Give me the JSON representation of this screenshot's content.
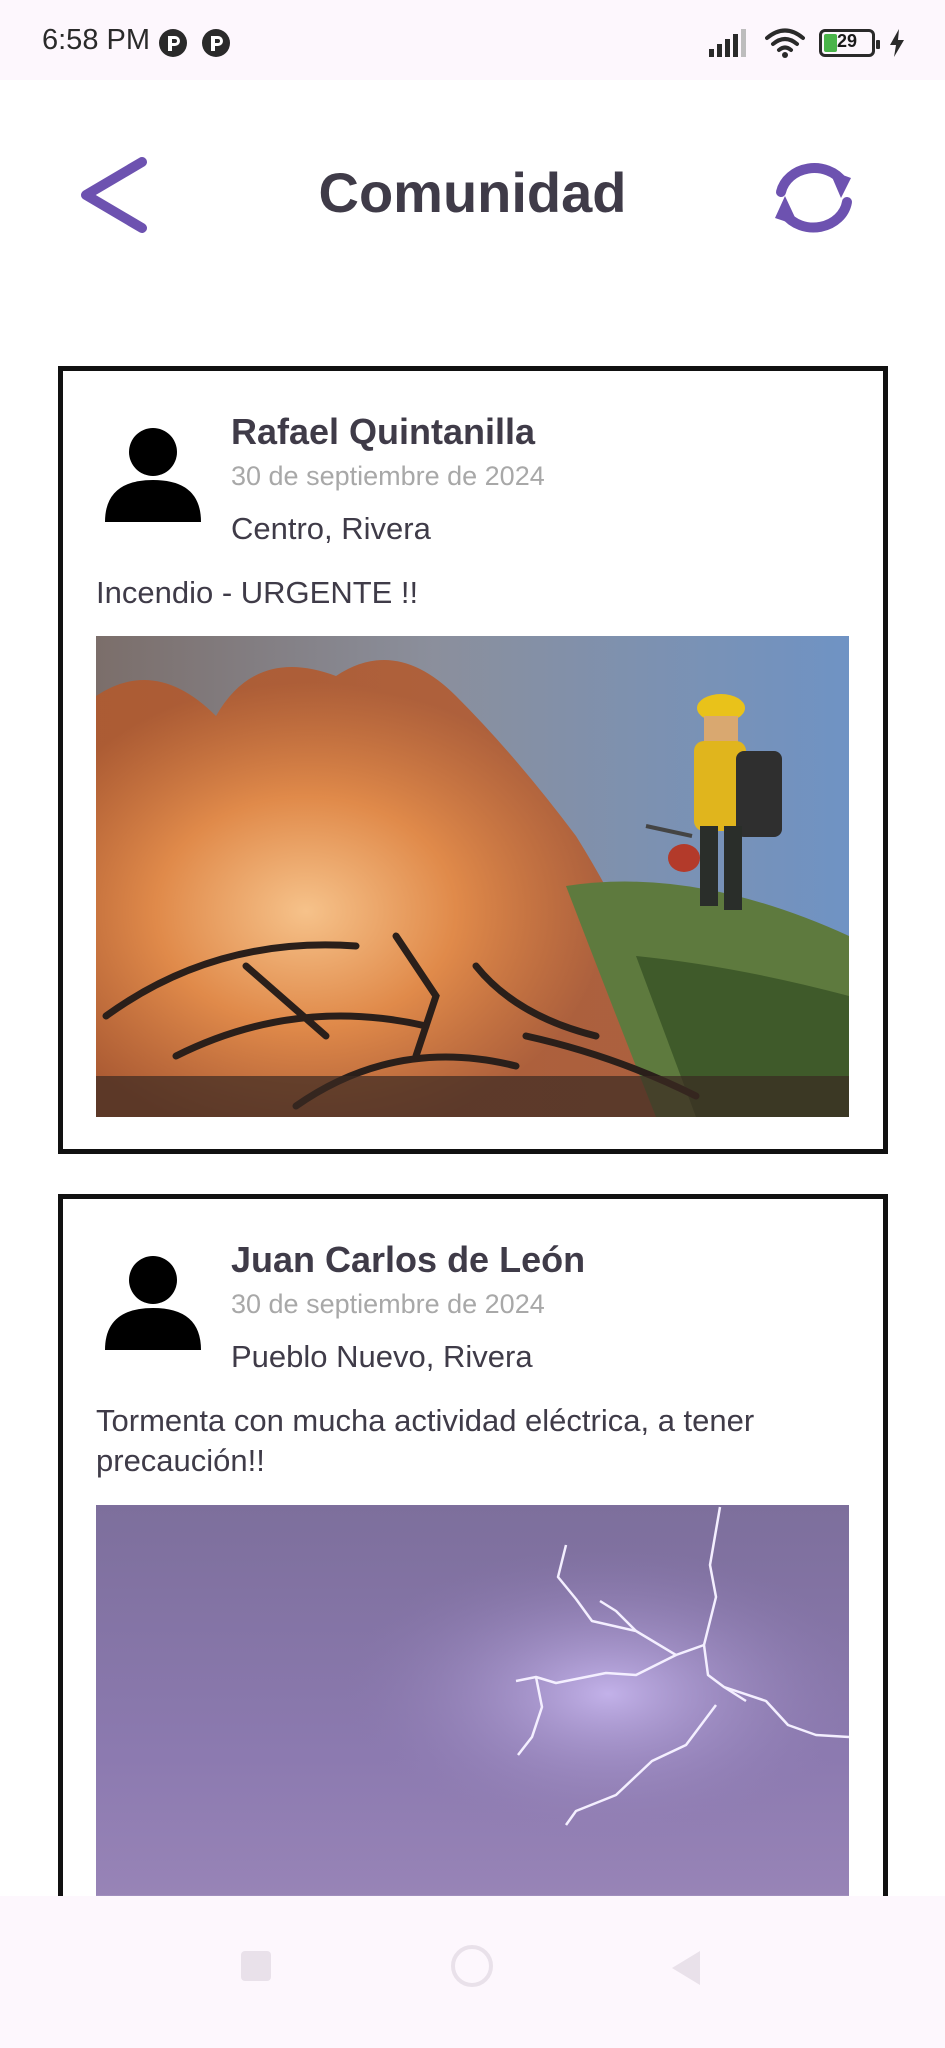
{
  "status_bar": {
    "time": "6:58 PM",
    "battery_level": "29",
    "battery_fraction": 0.29,
    "icons": [
      "app-notification-icon",
      "app-notification-icon",
      "signal-icon",
      "wifi-icon",
      "battery-icon",
      "charging-icon"
    ]
  },
  "header": {
    "title": "Comunidad",
    "back_icon": "chevron-left-icon",
    "refresh_icon": "refresh-icon"
  },
  "posts": [
    {
      "author": "Rafael Quintanilla",
      "date": "30 de septiembre de 2024",
      "location": "Centro, Rivera",
      "text": "Incendio - URGENTE !!",
      "image": "wildfire-photo"
    },
    {
      "author": "Juan Carlos de León",
      "date": "30 de septiembre de 2024",
      "location": "Pueblo Nuevo, Rivera",
      "text": "Tormenta con mucha actividad eléctrica, a tener precaución!!",
      "image": "lightning-photo"
    }
  ],
  "colors": {
    "accent": "#6d52b0",
    "title_text": "#3f3b48",
    "date_text": "#a8a8a8",
    "status_bar_bg": "#fdf7fd",
    "card_border": "#111111"
  },
  "nav_bar": {
    "icons": [
      "recents-icon",
      "home-icon",
      "back-icon"
    ]
  }
}
